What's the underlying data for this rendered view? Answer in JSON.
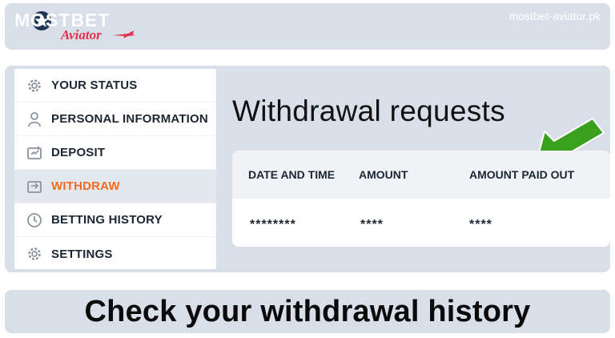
{
  "header": {
    "logo_main": "MOSTBET",
    "logo_sub": "Aviator",
    "site_url": "mostbet-aviator.pk"
  },
  "sidebar": {
    "items": [
      {
        "label": "YOUR STATUS",
        "icon": "gear-icon",
        "active": false
      },
      {
        "label": "PERSONAL INFORMATION",
        "icon": "user-icon",
        "active": false
      },
      {
        "label": "DEPOSIT",
        "icon": "deposit-icon",
        "active": false
      },
      {
        "label": "WITHDRAW",
        "icon": "withdraw-icon",
        "active": true
      },
      {
        "label": "BETTING HISTORY",
        "icon": "clock-icon",
        "active": false
      },
      {
        "label": "SETTINGS",
        "icon": "gear-icon",
        "active": false
      }
    ]
  },
  "main": {
    "title": "Withdrawal requests",
    "table": {
      "headers": [
        "DATE AND TIME",
        "AMOUNT",
        "AMOUNT PAID OUT"
      ],
      "rows": [
        [
          "********",
          "****",
          "****"
        ]
      ]
    }
  },
  "footer": {
    "caption": "Check your withdrawal history"
  },
  "colors": {
    "accent": "#f36b1f",
    "arrow": "#3aa11e",
    "panel_bg": "#d9dfe8"
  }
}
